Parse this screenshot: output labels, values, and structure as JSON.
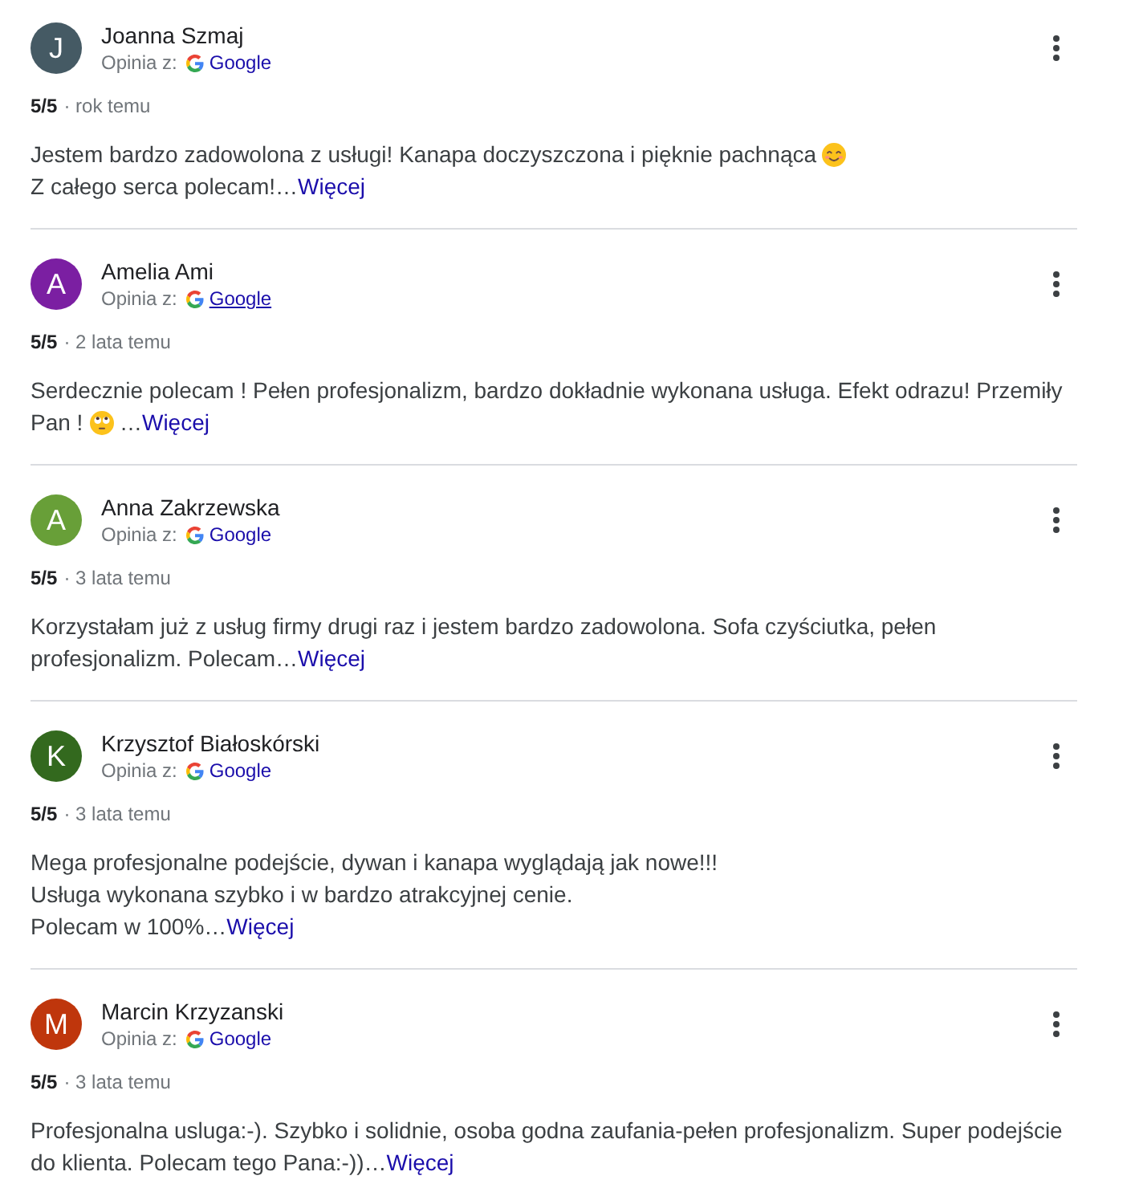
{
  "reviews": [
    {
      "initial": "J",
      "color": "#455a64",
      "name": "Joanna Szmaj",
      "source": {
        "label": "Opinia z:",
        "link": "Google",
        "hovered": false
      },
      "rating": "5/5",
      "meta": "· rok temu",
      "body": [
        {
          "kind": "text",
          "text": "Jestem bardzo zadowolona z usługi! Kanapa doczyszczona i pięknie pachnąca "
        },
        {
          "kind": "smile"
        },
        {
          "kind": "text",
          "text": "\nZ całego serca polecam!…"
        }
      ],
      "more_link": "Więcej"
    },
    {
      "initial": "A",
      "color": "#7b1fa2",
      "name": "Amelia Ami",
      "source": {
        "label": "Opinia z:",
        "link": "Google",
        "hovered": true
      },
      "rating": "5/5",
      "meta": "· 2 lata temu",
      "body": [
        {
          "kind": "text",
          "text": "Serdecznie polecam ! Pełen profesjonalizm, bardzo dokładnie wykonana usługa. Efekt odrazu! Przemiły\nPan ! "
        },
        {
          "kind": "eyeroll"
        },
        {
          "kind": "text",
          "text": " …"
        }
      ],
      "more_link": "Więcej"
    },
    {
      "initial": "A",
      "color": "#689f38",
      "name": "Anna Zakrzewska",
      "source": {
        "label": "Opinia z:",
        "link": "Google",
        "hovered": false
      },
      "rating": "5/5",
      "meta": "· 3 lata temu",
      "body": [
        {
          "kind": "text",
          "text": "Korzystałam już z usług firmy drugi raz i jestem bardzo zadowolona. Sofa czyściutka, pełen\nprofesjonalizm. Polecam…"
        }
      ],
      "more_link": "Więcej"
    },
    {
      "initial": "K",
      "color": "#33691e",
      "name": "Krzysztof Białoskórski",
      "source": {
        "label": "Opinia z:",
        "link": "Google",
        "hovered": false
      },
      "rating": "5/5",
      "meta": "· 3 lata temu",
      "body": [
        {
          "kind": "text",
          "text": "Mega profesjonalne podejście, dywan i kanapa wyglądają jak nowe!!!\nUsługa wykonana szybko i w bardzo atrakcyjnej cenie.\nPolecam w 100%…"
        }
      ],
      "more_link": "Więcej"
    },
    {
      "initial": "M",
      "color": "#bf360c",
      "name": "Marcin Krzyzanski",
      "source": {
        "label": "Opinia z:",
        "link": "Google",
        "hovered": false
      },
      "rating": "5/5",
      "meta": "· 3 lata temu",
      "body": [
        {
          "kind": "text",
          "text": "Profesjonalna usluga:-). Szybko i solidnie, osoba godna zaufania-pełen profesjonalizm. Super podejście\ndo klienta. Polecam tego Pana:-))…"
        }
      ],
      "more_link": "Więcej"
    }
  ]
}
